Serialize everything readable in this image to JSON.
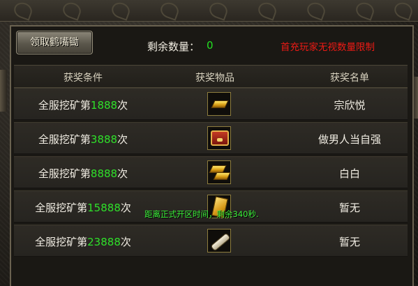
{
  "header": {
    "claim_button_label": "领取鹤嘴锄",
    "remaining_label": "剩余数量：",
    "remaining_value": "0",
    "notice": "首充玩家无视数量限制"
  },
  "table": {
    "columns": [
      "获奖条件",
      "获奖物品",
      "获奖名单"
    ],
    "rows": [
      {
        "cond_prefix": "全服挖矿第",
        "cond_num": "1888",
        "cond_suffix": "次",
        "item_icon": "gold-bar-icon",
        "winner": "宗欣悦"
      },
      {
        "cond_prefix": "全服挖矿第",
        "cond_num": "3888",
        "cond_suffix": "次",
        "item_icon": "treasure-chest-icon",
        "winner": "做男人当自强"
      },
      {
        "cond_prefix": "全服挖矿第",
        "cond_num": "8888",
        "cond_suffix": "次",
        "item_icon": "gold-bars-stack-icon",
        "winner": "白白"
      },
      {
        "cond_prefix": "全服挖矿第",
        "cond_num": "15888",
        "cond_suffix": "次",
        "item_icon": "gold-card-icon",
        "winner": "暂无"
      },
      {
        "cond_prefix": "全服挖矿第",
        "cond_num": "23888",
        "cond_suffix": "次",
        "item_icon": "scroll-icon",
        "winner": "暂无"
      }
    ]
  },
  "overlay_message": "距离正式开区时间，剩余340秒."
}
